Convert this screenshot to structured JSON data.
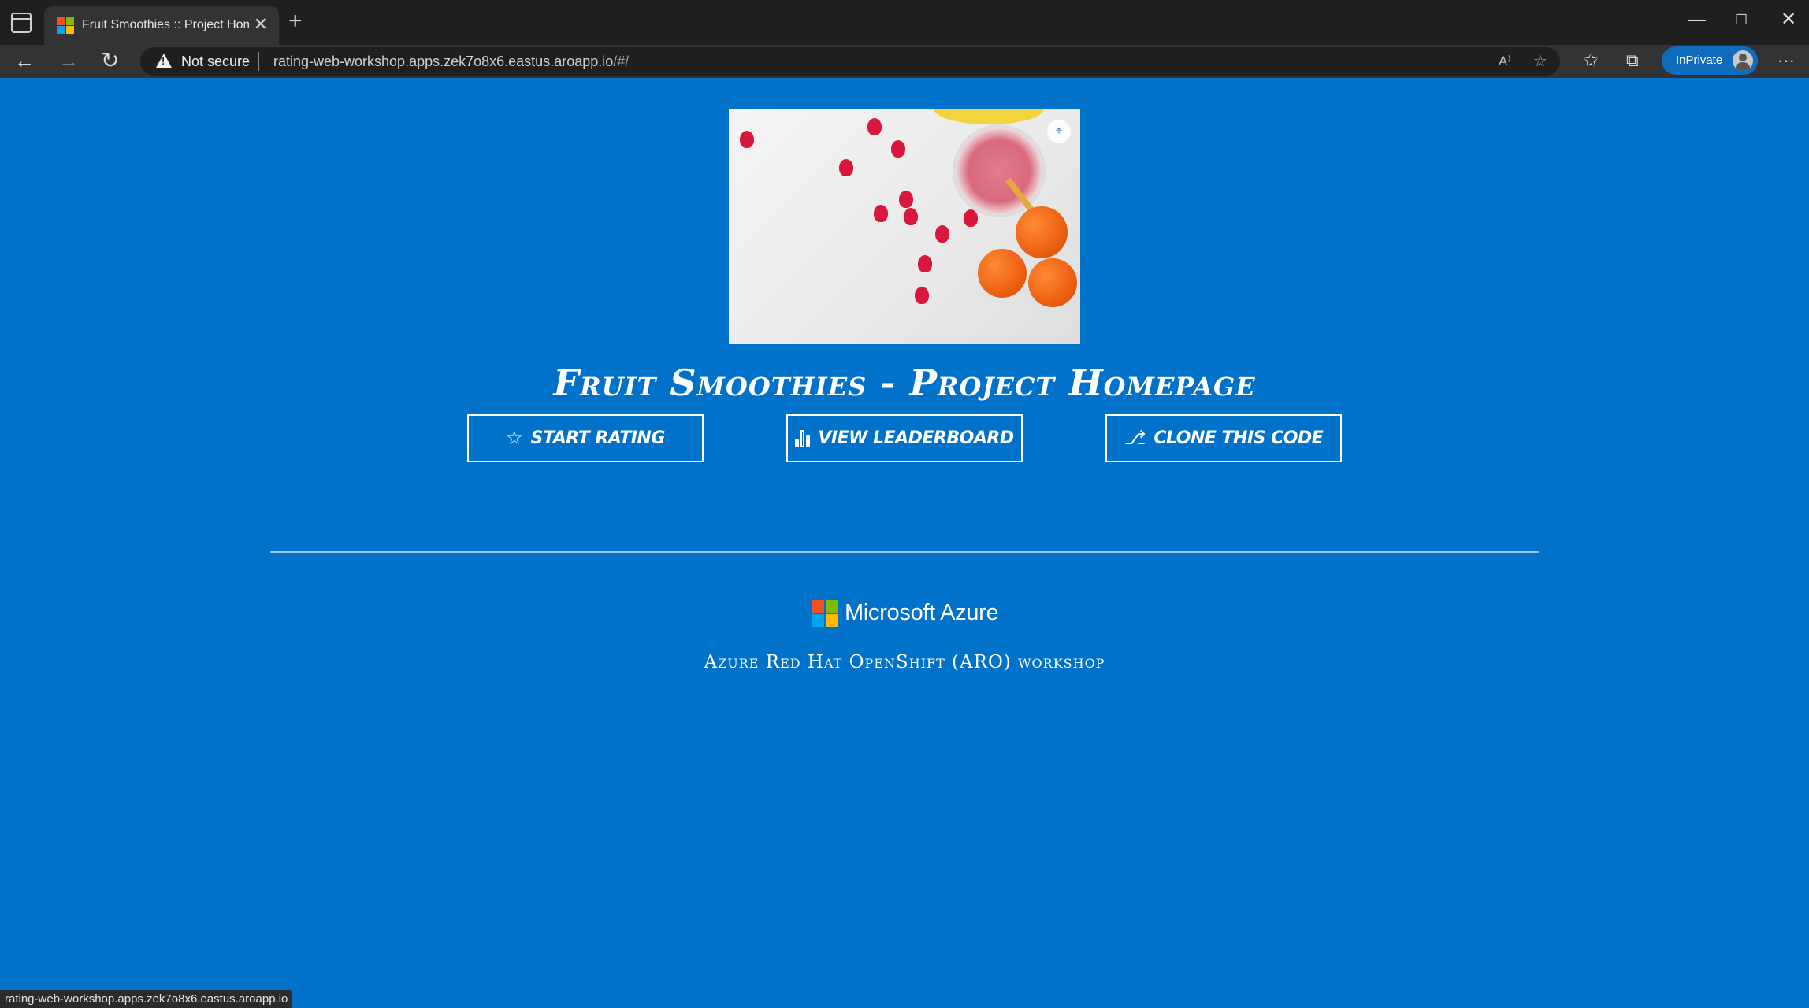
{
  "browser": {
    "tab": {
      "title": "Fruit Smoothies :: Project Homepage",
      "close_glyph": "✕"
    },
    "new_tab_glyph": "+",
    "window": {
      "minimize": "—",
      "maximize": "☐",
      "close": "✕"
    },
    "nav": {
      "back": "←",
      "forward": "→",
      "reload": "↻"
    },
    "address": {
      "security_label": "Not secure",
      "url_host": "rating-web-workshop.apps.zek7o8x6.eastus.aroapp.io",
      "url_path": "/#/"
    },
    "inprivate_label": "InPrivate",
    "icons": {
      "read_aloud": "A⁾",
      "add_favorite": "☆",
      "favorites": "✩",
      "collections": "⧉",
      "more": "···"
    }
  },
  "page": {
    "hero_icon": "⌖",
    "title": "Fruit Smoothies - Project Homepage",
    "buttons": [
      {
        "label": "Start Rating",
        "icon": "☆"
      },
      {
        "label": "View Leaderboard",
        "icon": "bar-chart"
      },
      {
        "label": "Clone this code",
        "icon": "github"
      }
    ],
    "github_glyph": "⎇",
    "footer": {
      "brand": "Microsoft Azure",
      "subtitle": "Azure Red Hat OpenShift (ARO) workshop"
    }
  },
  "status_bar": {
    "text": "rating-web-workshop.apps.zek7o8x6.eastus.aroapp.io"
  }
}
